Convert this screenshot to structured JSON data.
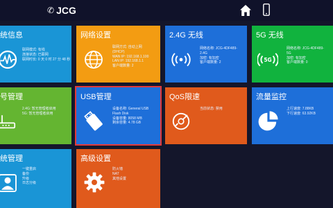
{
  "header": {
    "logo_text": "JCG",
    "logo_mark": "✆"
  },
  "tiles": {
    "system_info": {
      "title": "统信息",
      "lines": [
        "联网模式: 有线",
        "连接状态: 已联网",
        "联网时长: 0 天 0 时 27 分 48 秒"
      ]
    },
    "network_settings": {
      "title": "网络设置",
      "lines": [
        "联网方式: 自动上网",
        "(DHCP)",
        "WAN IP: 192.168.1.100",
        "LAN IP: 192.168.1.1",
        "客户端数量: 2"
      ]
    },
    "wifi_24g": {
      "title": "2.4G 无线",
      "lines": [
        "网络名称: JCG-4DF489-",
        "2.4G",
        "加密: 有加密",
        "客户端数量: 2"
      ]
    },
    "wifi_5g": {
      "title": "5G 无线",
      "lines": [
        "网络名称: JCG-4DF489-",
        "5G",
        "加密: 有加密",
        "客户端数量: 0"
      ]
    },
    "account_mgmt": {
      "title": "号管理",
      "lines": [
        "2.4G: 暂无管理者启用",
        "5G: 暂无管理者启用"
      ]
    },
    "usb_mgmt": {
      "title": "USB管理",
      "lines": [
        "设备名称: General USB",
        "Flash Disk",
        "设备容量: 8058 MB",
        "剩余容量: 4.78 GB"
      ]
    },
    "qos": {
      "title": "QoS限速",
      "lines": [
        "当前状态: 禁用"
      ]
    },
    "traffic": {
      "title": "流量监控",
      "lines": [
        "上行速度: 7.88KB",
        "下行速度: 63.92KB"
      ]
    },
    "sys_mgmt": {
      "title": "统管理",
      "lines": [
        "一键重启",
        "备份",
        "升级",
        "日志分级"
      ]
    },
    "advanced": {
      "title": "高级设置",
      "lines": [
        "防火墙",
        "NAT",
        "其他设置"
      ]
    }
  },
  "colors": {
    "background": "#14162b",
    "blue": "#1a95d6",
    "orange": "#f39c12",
    "dark_blue": "#1e6fd9",
    "green": "#11b33e",
    "light_green": "#64b531",
    "red_orange": "#e05a1c",
    "selection": "#e13a3a"
  }
}
